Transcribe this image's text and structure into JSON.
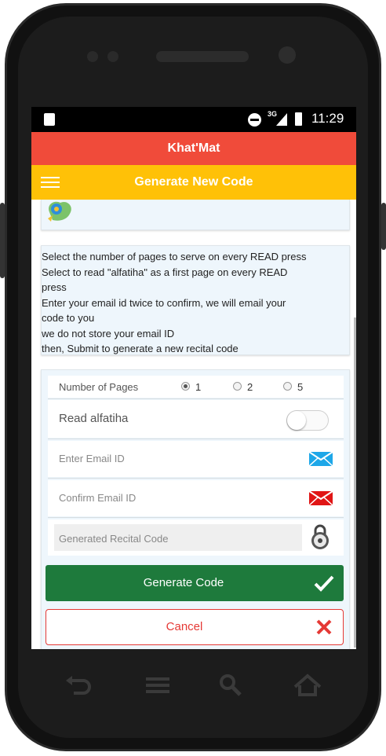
{
  "status_bar": {
    "network": "3G",
    "time": "11:29"
  },
  "app": {
    "title": "Khat'Mat"
  },
  "toolbar": {
    "title": "Generate New Code"
  },
  "info": {
    "lines": [
      "Select the number of pages to serve on every READ press",
      "Select to read \"alfatiha\" as a first page on every READ",
      "press",
      "Enter your email id twice to confirm, we will email your",
      "code to you",
      "we do not store your email ID",
      "then, Submit to generate a new recital code"
    ]
  },
  "form": {
    "pages_label": "Number of Pages",
    "page_options": [
      "1",
      "2",
      "5"
    ],
    "pages_selected": "1",
    "alfatiha_label": "Read alfatiha",
    "alfatiha_on": false,
    "email_placeholder": "Enter Email ID",
    "confirm_placeholder": "Confirm Email ID",
    "code_placeholder": "Generated Recital Code",
    "generate_label": "Generate Code",
    "cancel_label": "Cancel"
  },
  "colors": {
    "title_bar": "#f04b3a",
    "toolbar": "#ffc107",
    "generate_button": "#1e7a3c",
    "cancel": "#e53935"
  },
  "icons": [
    "sd-card-icon",
    "dnd-icon",
    "signal-icon",
    "battery-icon",
    "menu-icon",
    "app-logo",
    "envelope-blue-icon",
    "envelope-red-icon",
    "lock-icon",
    "check-icon",
    "close-icon",
    "back-icon",
    "menu-nav-icon",
    "search-icon",
    "home-icon"
  ]
}
